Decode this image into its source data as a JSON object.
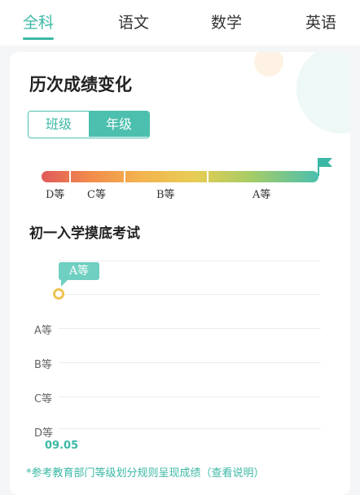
{
  "tabs": [
    {
      "label": "全科",
      "active": true
    },
    {
      "label": "语文",
      "active": false
    },
    {
      "label": "数学",
      "active": false
    },
    {
      "label": "英语",
      "active": false
    }
  ],
  "card": {
    "title": "历次成绩变化",
    "toggle": {
      "left_label": "班级",
      "right_label": "年级",
      "selected": "年级"
    },
    "grade_scale": {
      "labels": [
        "D等",
        "C等",
        "B等",
        "A等"
      ],
      "colors": [
        "#e05a5a",
        "#f28c4c",
        "#e8cd55",
        "#4cbfae"
      ],
      "flag_icon": "flag-icon"
    },
    "exam_title": "初一入学摸底考试",
    "note": "*参考教育部门等级划分规则呈现成绩（查看说明）"
  },
  "chart_data": {
    "type": "line",
    "y_categories": [
      "D等",
      "C等",
      "B等",
      "A等"
    ],
    "y_labels_shown": [
      "A等",
      "B等",
      "C等",
      "D等"
    ],
    "x": [
      "09.05"
    ],
    "series": [
      {
        "values": [
          "A等"
        ]
      }
    ],
    "tooltip": "A等",
    "point_color": "#f0c352",
    "tooltip_color": "#6fcfc0",
    "grid": true
  }
}
